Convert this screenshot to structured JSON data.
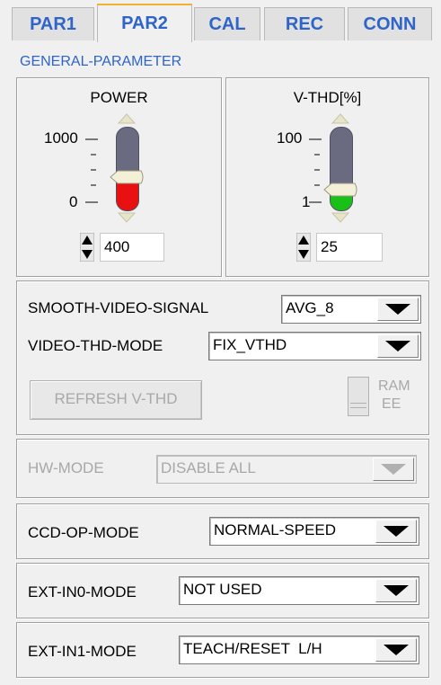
{
  "tabs": [
    {
      "label": "PAR1",
      "active": false
    },
    {
      "label": "PAR2",
      "active": true
    },
    {
      "label": "CAL",
      "active": false
    },
    {
      "label": "REC",
      "active": false
    },
    {
      "label": "CONN",
      "active": false
    }
  ],
  "section_title": "GENERAL-PARAMETER",
  "power": {
    "title": "POWER",
    "scale_max": "1000",
    "scale_min": "0",
    "value": "400",
    "slider_level": 0.4,
    "fill_color": "#e81010"
  },
  "vthd": {
    "title": "V-THD[%]",
    "scale_max": "100",
    "scale_min": "1",
    "value": "25",
    "slider_level": 0.25,
    "fill_color": "#18c018"
  },
  "smooth": {
    "label": "SMOOTH-VIDEO-SIGNAL",
    "value": "AVG_8"
  },
  "vthd_mode": {
    "label": "VIDEO-THD-MODE",
    "value": "FIX_VTHD"
  },
  "refresh_button": "REFRESH V-THD",
  "ram_ee": {
    "top": "RAM",
    "bottom": "EE"
  },
  "hw_mode": {
    "label": "HW-MODE",
    "value": "DISABLE ALL"
  },
  "ccd_op_mode": {
    "label": "CCD-OP-MODE",
    "value": "NORMAL-SPEED"
  },
  "ext_in0_mode": {
    "label": "EXT-IN0-MODE",
    "value": "NOT USED"
  },
  "ext_in1_mode": {
    "label": "EXT-IN1-MODE",
    "value": "TEACH/RESET  L/H"
  },
  "colors": {
    "tab_text": "#2f64c8",
    "accent_tab_border": "#f0b030"
  }
}
